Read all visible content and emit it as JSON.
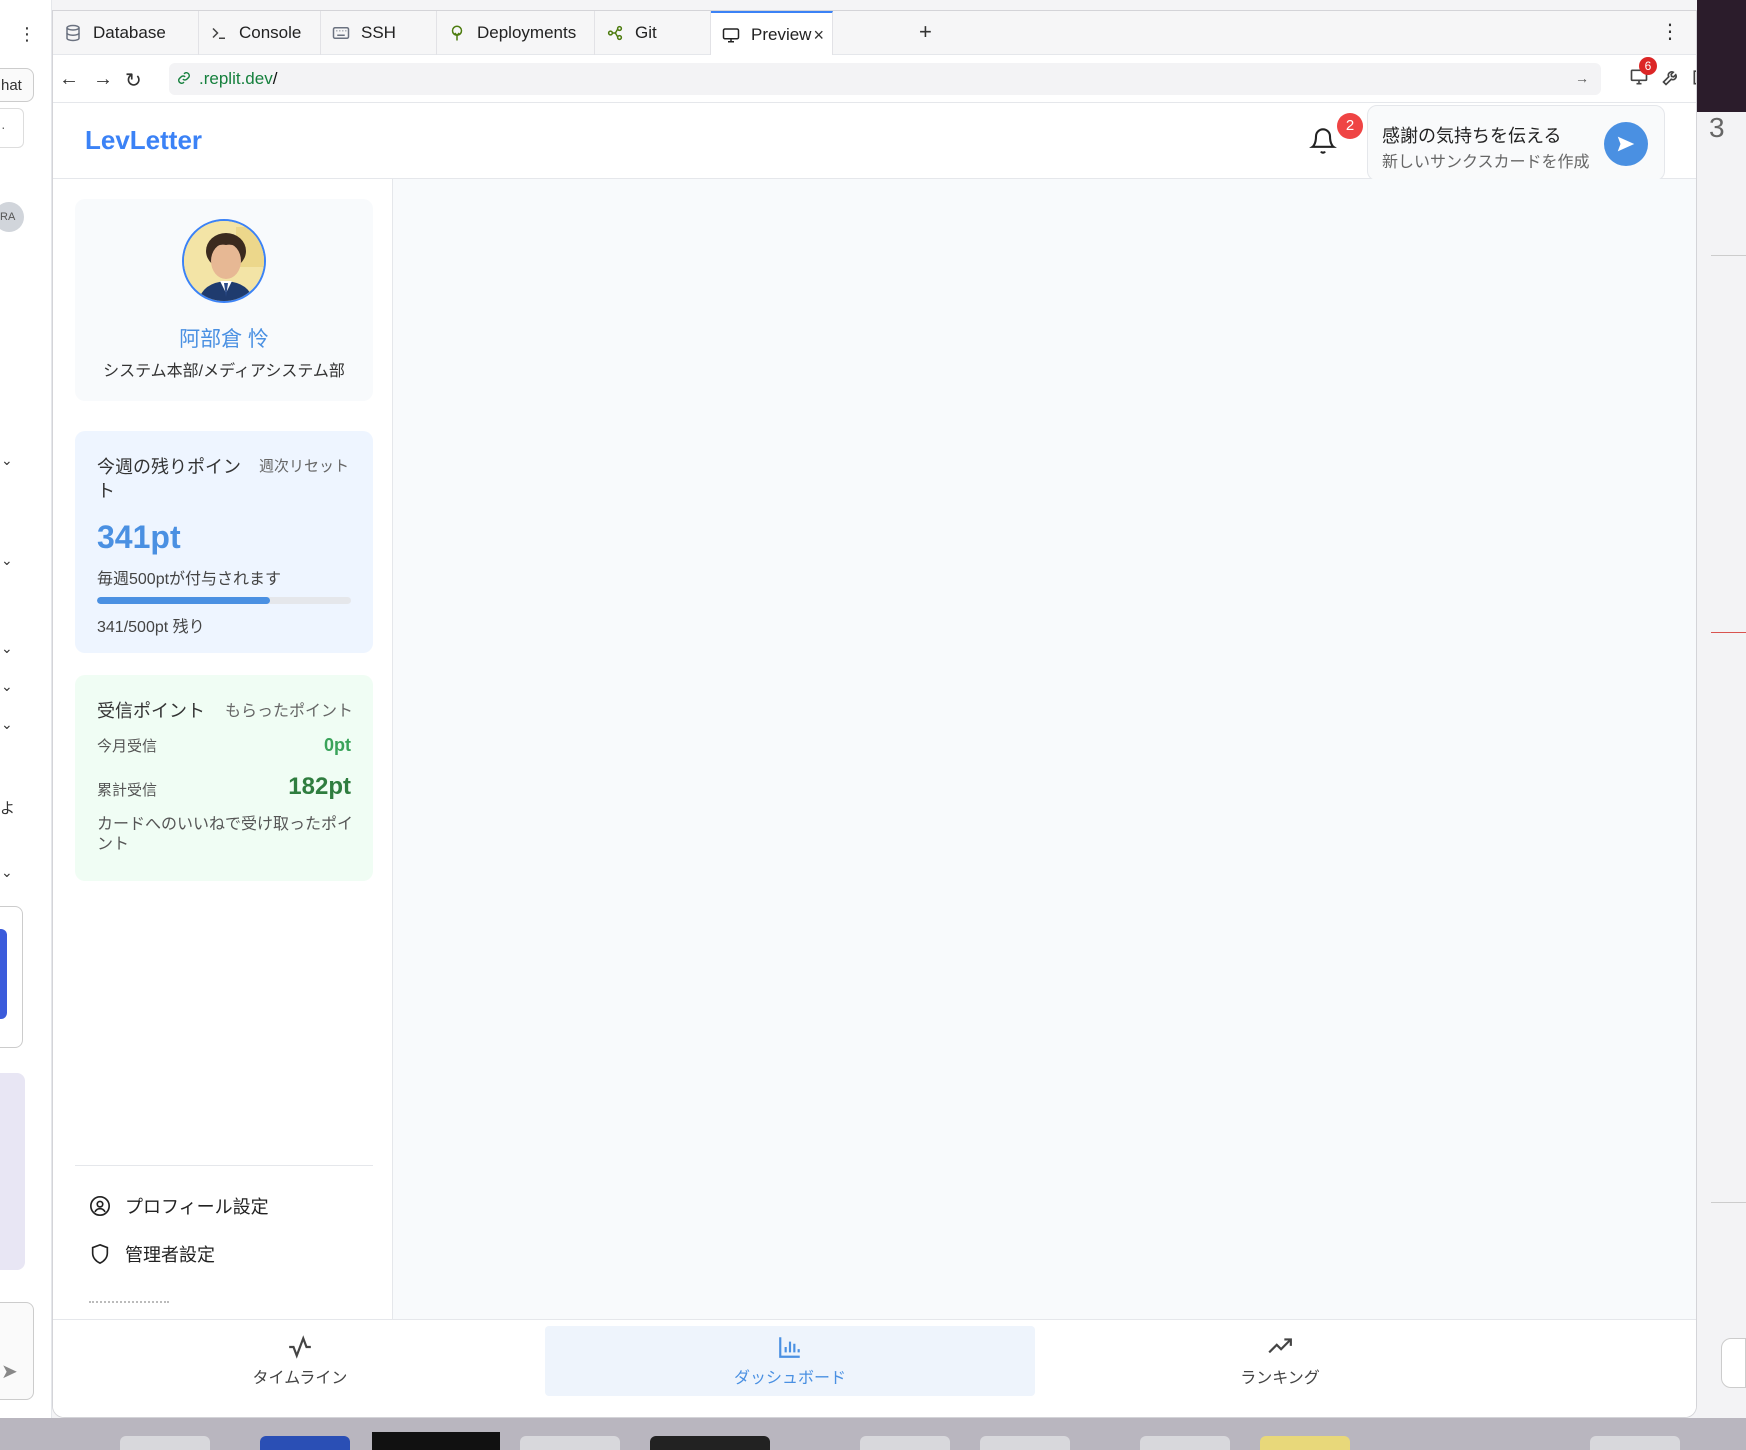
{
  "tabs": [
    {
      "label": "Database",
      "icon": "database-icon"
    },
    {
      "label": "Console",
      "icon": "terminal-icon"
    },
    {
      "label": "SSH",
      "icon": "keyboard-icon"
    },
    {
      "label": "Deployments",
      "icon": "deployments-icon"
    },
    {
      "label": "Git",
      "icon": "git-icon"
    },
    {
      "label": "Preview",
      "icon": "monitor-icon",
      "active": true
    }
  ],
  "addressbar": {
    "url_host": ".replit.dev",
    "url_path": "/",
    "devtools_badge": "6"
  },
  "left_strip": {
    "chat_label": "hat",
    "avatar_initials": "RA",
    "partial_text": "よ"
  },
  "desktop": {
    "partial_number": "3"
  },
  "app": {
    "brand": "LevLetter",
    "notification_count": "2",
    "cta": {
      "title": "感謝の気持ちを伝える",
      "subtitle": "新しいサンクスカードを作成"
    },
    "profile": {
      "name": "阿部倉 怜",
      "department": "システム本部/メディアシステム部"
    },
    "weekly": {
      "title": "今週の残りポイント",
      "subtitle": "週次リセット",
      "points": "341pt",
      "note": "毎週500ptが付与されます",
      "remaining_text": "341/500pt 残り",
      "progress": 0.682
    },
    "received": {
      "title": "受信ポイント",
      "subtitle": "もらったポイント",
      "month_label": "今月受信",
      "month_value": "0pt",
      "total_label": "累計受信",
      "total_value": "182pt",
      "description": "カードへのいいねで受け取ったポイント"
    },
    "menu": [
      {
        "label": "プロフィール設定",
        "icon": "user-circle-icon"
      },
      {
        "label": "管理者設定",
        "icon": "shield-icon"
      }
    ],
    "bottom_nav": [
      {
        "label": "タイムライン",
        "icon": "activity-icon"
      },
      {
        "label": "ダッシュボード",
        "icon": "bar-chart-icon",
        "active": true
      },
      {
        "label": "ランキング",
        "icon": "trending-up-icon"
      }
    ]
  },
  "colors": {
    "accent": "#4a90e2",
    "badge": "#ef4444",
    "green": "#2f7d3f"
  }
}
